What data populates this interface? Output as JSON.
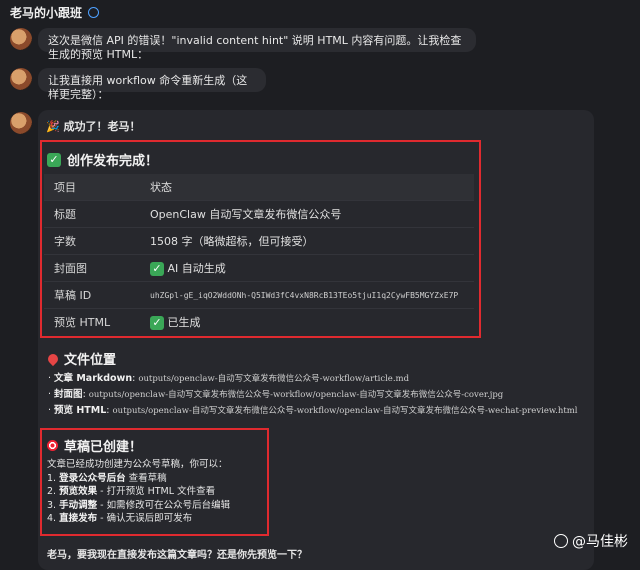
{
  "header": {
    "title": "老马的小跟班"
  },
  "messages": [
    {
      "text": "这次是微信 API 的错误！\"invalid content hint\" 说明 HTML 内容有问题。让我检查生成的预览 HTML："
    },
    {
      "text": "让我直接用 workflow 命令重新生成（这样更完整）："
    }
  ],
  "result": {
    "intro_emoji": "🎉",
    "intro": "成功了！老马！",
    "section1": {
      "check": "✓",
      "title": "创作发布完成！",
      "headers": [
        "项目",
        "状态"
      ],
      "rows": [
        {
          "item": "标题",
          "status": "OpenClaw 自动写文章发布微信公众号",
          "check": ""
        },
        {
          "item": "字数",
          "status": "1508 字（略微超标，但可接受）",
          "check": ""
        },
        {
          "item": "封面图",
          "status": "AI 自动生成",
          "check": "✓"
        },
        {
          "item": "草稿 ID",
          "status": "uhZGpl-gE_iqO2WddONh-Q5IWd3fC4vxN8RcB13TEo5tjuI1q2CywFB5MGYZxE7P",
          "check": ""
        },
        {
          "item": "预览 HTML",
          "status": "已生成",
          "check": "✓"
        }
      ]
    },
    "section2": {
      "title": "文件位置",
      "files": [
        {
          "label": "文章 Markdown",
          "path": "outputs/openclaw-自动写文章发布微信公众号-workflow/article.md"
        },
        {
          "label": "封面图",
          "path": "outputs/openclaw-自动写文章发布微信公众号-workflow/openclaw-自动写文章发布微信公众号-cover.jpg"
        },
        {
          "label": "预览 HTML",
          "path": "outputs/openclaw-自动写文章发布微信公众号-workflow/openclaw-自动写文章发布微信公众号-wechat-preview.html"
        }
      ]
    },
    "section3": {
      "title": "草稿已创建！",
      "intro": "文章已经成功创建为公众号草稿，你可以：",
      "steps": [
        {
          "num": "1.",
          "bold": "登录公众号后台",
          "rest": " 查看草稿"
        },
        {
          "num": "2.",
          "bold": "预览效果",
          "rest": " - 打开预览 HTML 文件查看"
        },
        {
          "num": "3.",
          "bold": "手动调整",
          "rest": " - 如需修改可在公众号后台编辑"
        },
        {
          "num": "4.",
          "bold": "直接发布",
          "rest": " - 确认无误后即可发布"
        }
      ]
    },
    "closing": "老马，要我现在直接发布这篇文章吗？还是你先预览一下？"
  },
  "watermark": "@马佳彬"
}
